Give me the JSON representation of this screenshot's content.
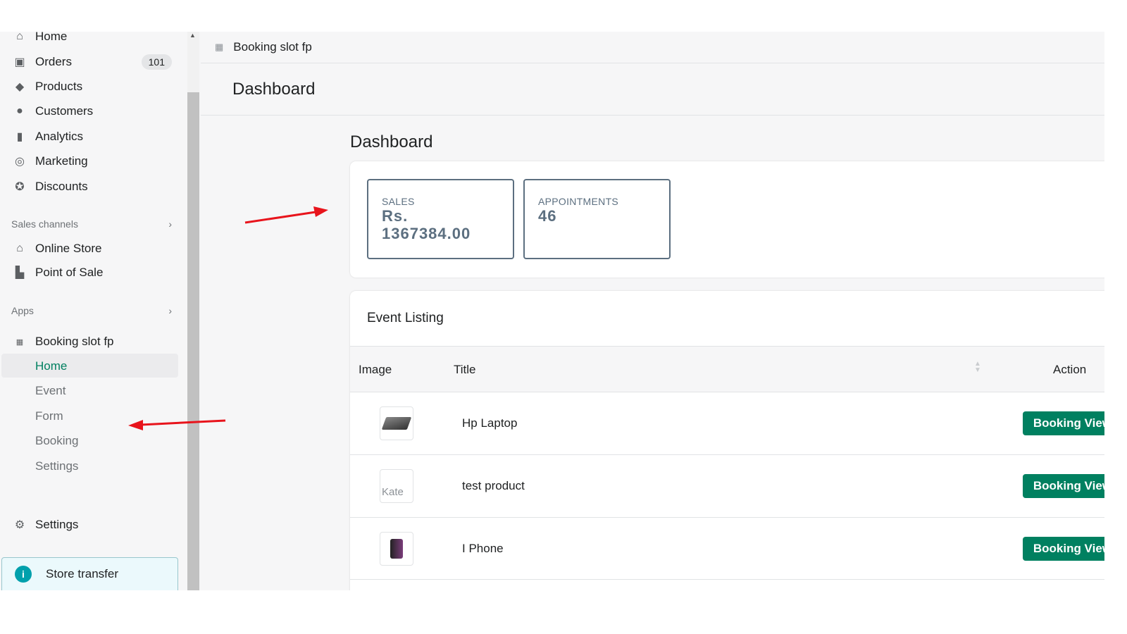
{
  "sidebar": {
    "items": [
      {
        "label": "Home",
        "icon": "home-icon"
      },
      {
        "label": "Orders",
        "icon": "orders-icon",
        "badge": "101"
      },
      {
        "label": "Products",
        "icon": "tag-icon"
      },
      {
        "label": "Customers",
        "icon": "person-icon"
      },
      {
        "label": "Analytics",
        "icon": "bar-chart-icon"
      },
      {
        "label": "Marketing",
        "icon": "target-icon"
      },
      {
        "label": "Discounts",
        "icon": "discount-icon"
      }
    ],
    "sales_channels": "Sales channels",
    "channels": [
      {
        "label": "Online Store",
        "icon": "store-icon"
      },
      {
        "label": "Point of Sale",
        "icon": "shopping-bag-icon"
      }
    ],
    "apps": "Apps",
    "app_name": "Booking slot fp",
    "app_items": [
      "Home",
      "Event",
      "Form",
      "Booking",
      "Settings"
    ],
    "settings": "Settings",
    "store_transfer": "Store transfer"
  },
  "topbar": {
    "app_name": "Booking slot fp"
  },
  "page_title": "Dashboard",
  "main": {
    "heading": "Dashboard",
    "stats": [
      {
        "label": "SALES",
        "value_line1": "Rs.",
        "value_line2": "1367384.00"
      },
      {
        "label": "APPOINTMENTS",
        "value": "46"
      }
    ],
    "event_listing": {
      "title": "Event Listing",
      "columns": [
        "Image",
        "Title",
        "Action"
      ],
      "rows": [
        {
          "title": "Hp Laptop",
          "action": "Booking View"
        },
        {
          "title": "test product",
          "image_alt": "Kate",
          "action": "Booking View"
        },
        {
          "title": "I Phone",
          "action": "Booking View"
        }
      ]
    }
  },
  "colors": {
    "primary": "#008060",
    "annotation_arrow": "#e8141c"
  }
}
